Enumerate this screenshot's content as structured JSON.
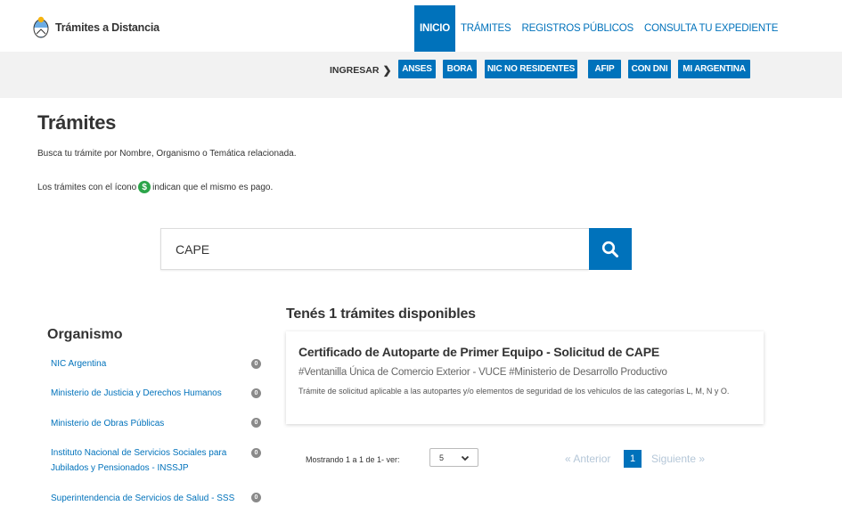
{
  "header": {
    "brand": "Trámites a Distancia",
    "nav": [
      "INICIO",
      "TRÁMITES",
      "REGISTROS PÚBLICOS",
      "CONSULTA TU EXPEDIENTE"
    ]
  },
  "subbar": {
    "ingresar": "INGRESAR",
    "buttons": [
      "ANSES",
      "BORA",
      "NIC NO RESIDENTES",
      "AFIP",
      "CON DNI",
      "MI ARGENTINA"
    ]
  },
  "page": {
    "title": "Trámites",
    "description": "Busca tu trámite por Nombre, Organismo o Temática relacionada.",
    "paid_note_before": "Los trámites con el ícono",
    "paid_note_after": "indican que el mismo es pago.",
    "paid_icon": "$"
  },
  "search": {
    "value": "CAPE"
  },
  "results": {
    "heading": "Tenés 1 trámites disponibles",
    "items": [
      {
        "title": "Certificado de Autoparte de Primer Equipo - Solicitud de CAPE",
        "tags": "#Ventanilla Única de Comercio Exterior - VUCE #Ministerio de Desarrollo Productivo",
        "description": "Trámite de solicitud aplicable a las autopartes y/o elementos de seguridad de los vehiculos de las categorías L, M, N y O."
      }
    ]
  },
  "organismo": {
    "title": "Organismo",
    "items": [
      {
        "label": "NIC Argentina",
        "count": "0"
      },
      {
        "label": "Ministerio de Justicia y Derechos Humanos",
        "count": "0"
      },
      {
        "label": "Ministerio de Obras Públicas",
        "count": "0"
      },
      {
        "label": "Instituto Nacional de Servicios Sociales para Jubilados y Pensionados - INSSJP",
        "count": "0"
      },
      {
        "label": "Superintendencia de Servicios de Salud - SSS",
        "count": "0"
      }
    ]
  },
  "pagination": {
    "showing": "Mostrando 1 a 1 de 1- ver:",
    "per_page": "5",
    "prev": "« Anterior",
    "current": "1",
    "next": "Siguiente »"
  },
  "colors": {
    "primary": "#0072bb",
    "paid_icon": "#2ca54a",
    "subbar_bg": "#f2f2f2"
  }
}
